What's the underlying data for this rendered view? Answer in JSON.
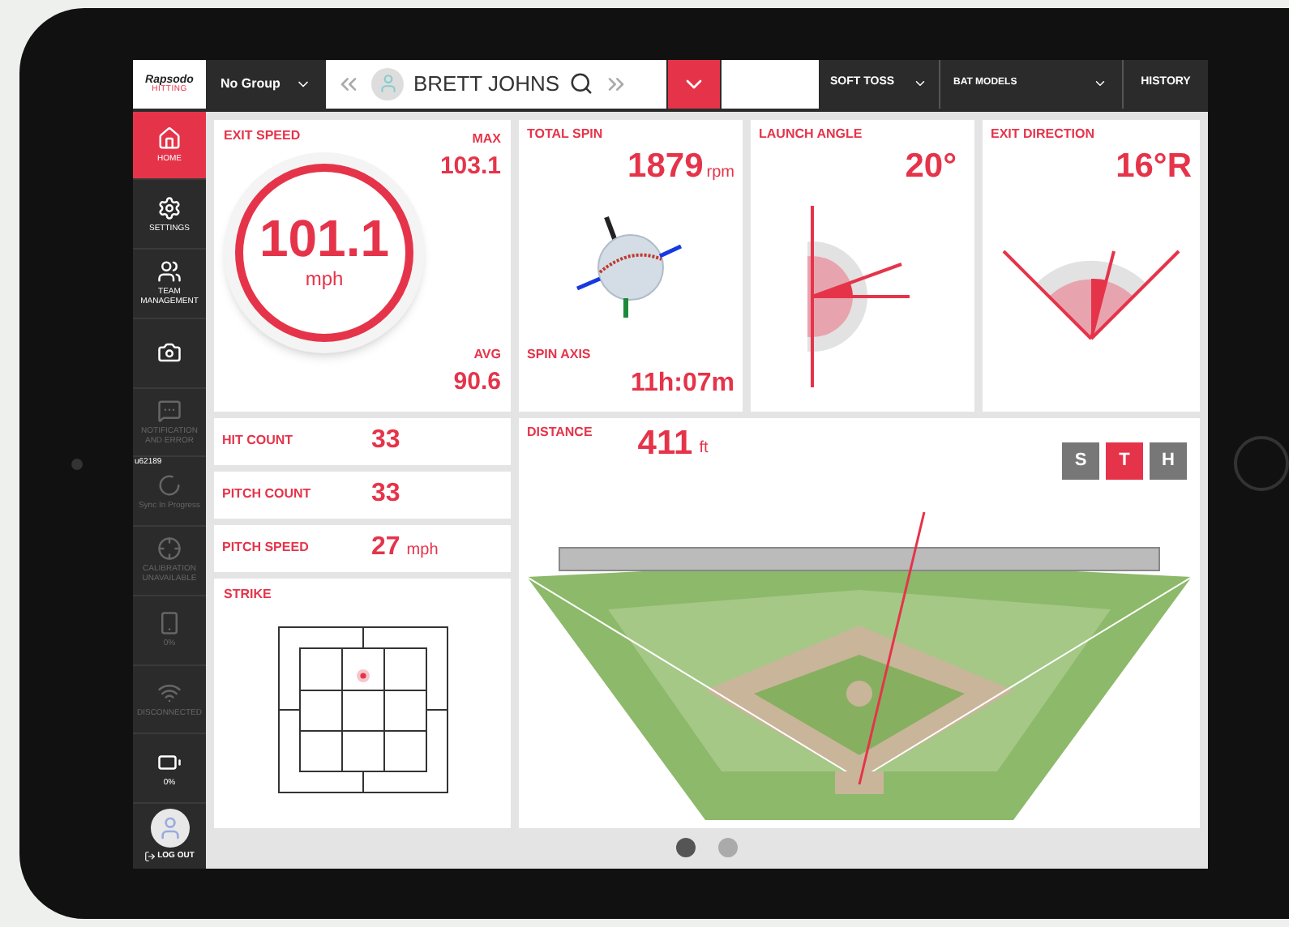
{
  "top_bar": {
    "logo_name": "Rapsodo",
    "logo_product": "HITTING",
    "group": "No Group",
    "player": "BRETT JOHNS",
    "mode": "SOFT TOSS",
    "bat": "BAT MODELS",
    "history": "HISTORY"
  },
  "sidebar": {
    "items": [
      {
        "label": "HOME",
        "selected": true,
        "disabled": false
      },
      {
        "label": "SETTINGS",
        "selected": false,
        "disabled": false
      },
      {
        "label": "TEAM MANAGEMENT",
        "selected": false,
        "disabled": false
      },
      {
        "selected": false,
        "disabled": false
      },
      {
        "label": "NOTIFICATION AND ERROR",
        "selected": false,
        "disabled": true
      },
      {
        "label": "Sync In Progress",
        "badge": "u62189",
        "selected": false,
        "disabled": true
      },
      {
        "label": "CALIBRATION UNAVAILABLE",
        "selected": false,
        "disabled": true
      },
      {
        "label": "0%",
        "selected": false,
        "disabled": true
      },
      {
        "label": "DISCONNECTED",
        "selected": false,
        "disabled": true
      },
      {
        "label": "0%",
        "selected": false,
        "disabled": false
      }
    ],
    "logout": "LOG OUT"
  },
  "exit_speed": {
    "title": "EXIT SPEED",
    "value": "101.1",
    "unit": "mph",
    "max_label": "MAX",
    "max": "103.1",
    "avg_label": "AVG",
    "avg": "90.6"
  },
  "total_spin": {
    "title": "TOTAL SPIN",
    "value": "1879",
    "unit": "rpm",
    "axis_title": "SPIN AXIS",
    "axis": "11h:07m"
  },
  "launch_angle": {
    "title": "LAUNCH ANGLE",
    "value": "20°"
  },
  "exit_direction": {
    "title": "EXIT DIRECTION",
    "value": "16°R"
  },
  "counts": [
    {
      "label": "HIT COUNT",
      "value": "33"
    },
    {
      "label": "PITCH COUNT",
      "value": "33"
    },
    {
      "label": "PITCH SPEED",
      "value": "27",
      "unit": "mph"
    }
  ],
  "strike": {
    "title": "STRIKE"
  },
  "distance": {
    "title": "DISTANCE",
    "value": "411",
    "unit": "ft",
    "views": [
      {
        "label": "S",
        "selected": false
      },
      {
        "label": "T",
        "selected": true
      },
      {
        "label": "H",
        "selected": false
      }
    ]
  },
  "pager": [
    {
      "selected": true
    },
    {
      "selected": false
    }
  ]
}
